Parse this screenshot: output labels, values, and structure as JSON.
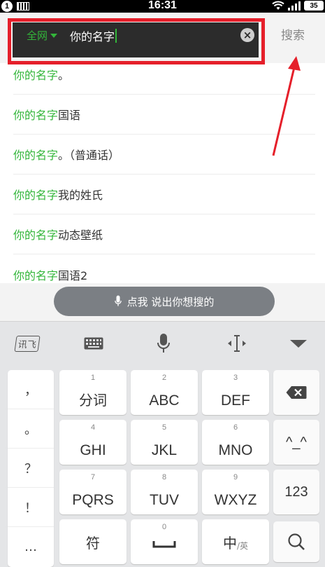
{
  "status_bar": {
    "notification_count": "1",
    "time": "16:31",
    "battery": "35"
  },
  "search": {
    "scope_label": "全网",
    "query": "你的名字",
    "search_button": "搜索"
  },
  "suggestions": [
    {
      "highlight": "你的名字",
      "rest": "。"
    },
    {
      "highlight": "你的名字",
      "rest": "国语"
    },
    {
      "highlight": "你的名字",
      "rest": "。（普通话）"
    },
    {
      "highlight": "你的名字",
      "rest": "我的姓氏"
    },
    {
      "highlight": "你的名字",
      "rest": "动态壁纸"
    },
    {
      "highlight": "你的名字",
      "rest": "国语2"
    }
  ],
  "voice": {
    "label": "点我 说出你想搜的"
  },
  "keyboard_toolbar": {
    "logo": "讯飞"
  },
  "keyboard": {
    "punctuation": [
      "，",
      "。",
      "？",
      "！",
      "…"
    ],
    "keys": {
      "k1": {
        "num": "1",
        "label": "分词"
      },
      "k2": {
        "num": "2",
        "label": "ABC"
      },
      "k3": {
        "num": "3",
        "label": "DEF"
      },
      "k4": {
        "num": "4",
        "label": "GHI"
      },
      "k5": {
        "num": "5",
        "label": "JKL"
      },
      "k6": {
        "num": "6",
        "label": "MNO"
      },
      "k7": {
        "num": "7",
        "label": "PQRS"
      },
      "k8": {
        "num": "8",
        "label": "TUV"
      },
      "k9": {
        "num": "9",
        "label": "WXYZ"
      },
      "k0": {
        "num": "0"
      },
      "symbols": "符",
      "lang_main": "中",
      "lang_sub": "/英",
      "emoticon": "^_^",
      "numbers": "123"
    }
  },
  "colors": {
    "accent_green": "#33b63a",
    "highlight_red": "#e51f2a",
    "search_bg": "#2c2c2c"
  }
}
